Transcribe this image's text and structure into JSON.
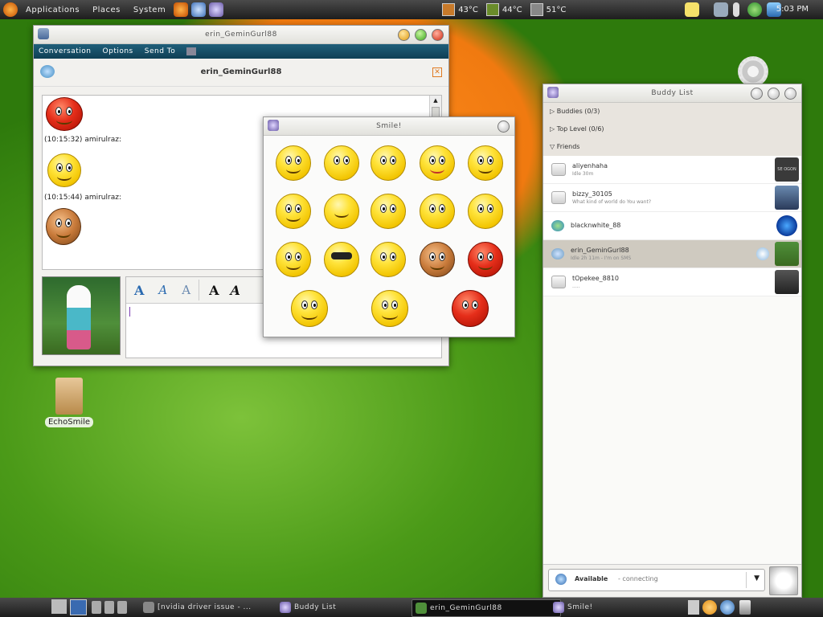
{
  "topbar": {
    "menus": [
      "Applications",
      "Places",
      "System"
    ],
    "sensors": [
      "43°C",
      "44°C",
      "51°C"
    ],
    "clock": "5:03 PM"
  },
  "desktop": {
    "icon_label": "EchoSmile"
  },
  "chat": {
    "title": "erin_GeminGurl88",
    "menu": [
      "Conversation",
      "Options",
      "Send To"
    ],
    "buddy": "erin_GeminGurl88",
    "messages": [
      {
        "time": "(10:15:32)",
        "sender": "amirulraz:"
      },
      {
        "time": "(10:15:44)",
        "sender": "amirulraz:"
      }
    ],
    "format_glyphs": [
      "A",
      "A",
      "A",
      "A",
      "A"
    ]
  },
  "smiley": {
    "title": "Smile!"
  },
  "buddylist": {
    "title": "Buddy List",
    "groups": [
      "Buddies (0/3)",
      "Top Level (0/6)",
      "Friends"
    ],
    "buddies": [
      {
        "name": "aliyenhaha",
        "sub": "Idle 30m"
      },
      {
        "name": "bizzy_30105",
        "sub": "What kind of world do You want?"
      },
      {
        "name": "blacknwhite_88",
        "sub": ""
      },
      {
        "name": "erin_GeminGurl88",
        "sub": "Idle 2h 11m - I'm on SMS"
      },
      {
        "name": "tOpekee_8810",
        "sub": "....."
      }
    ],
    "status": "Available",
    "status_detail": "- connecting",
    "avatar1_text": "SE OGON"
  },
  "taskbar": {
    "tasks": [
      "[nvidia driver issue - ...",
      "Buddy List",
      "erin_GeminGurl88",
      "Smile!"
    ]
  },
  "colors": {
    "accent": "#1f5f7a",
    "selection": "#cfcac0"
  }
}
